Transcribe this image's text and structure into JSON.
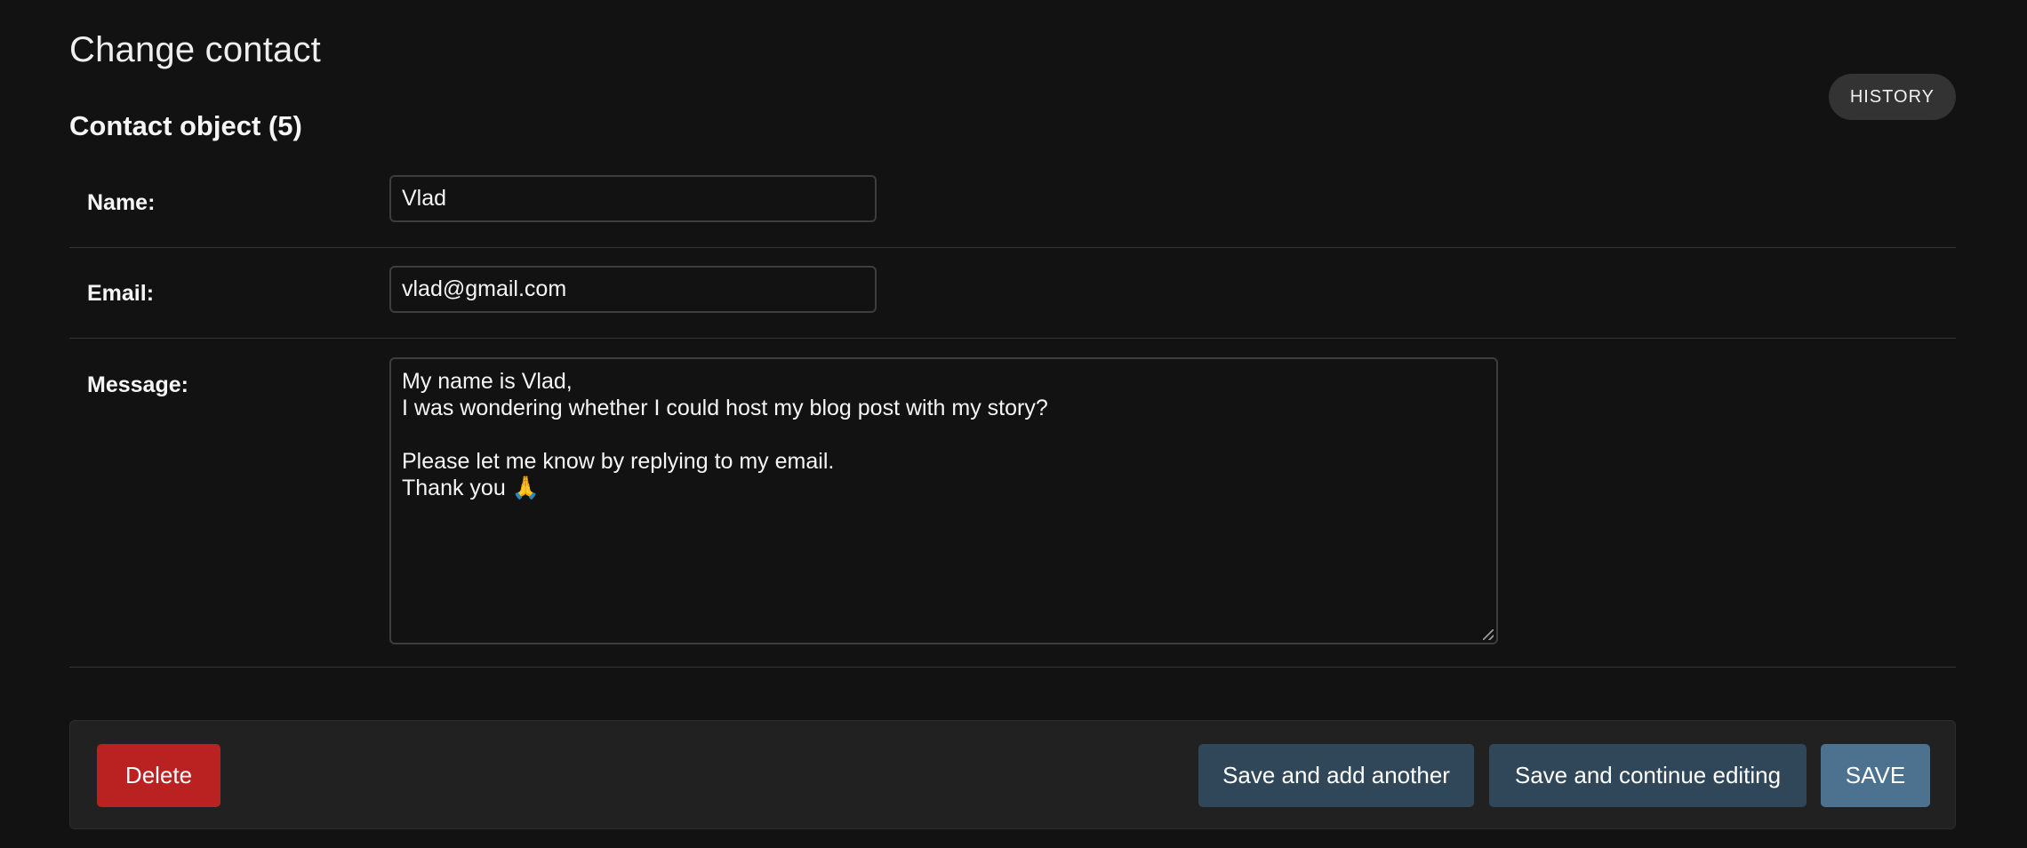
{
  "header": {
    "title": "Change contact",
    "history_label": "HISTORY"
  },
  "object": {
    "title": "Contact object (5)"
  },
  "fields": {
    "name": {
      "label": "Name:",
      "value": "Vlad"
    },
    "email": {
      "label": "Email:",
      "value": "vlad@gmail.com"
    },
    "message": {
      "label": "Message:",
      "value": "My name is Vlad,\nI was wondering whether I could host my blog post with my story?\n\nPlease let me know by replying to my email.\nThank you 🙏"
    }
  },
  "actions": {
    "delete_label": "Delete",
    "save_add_another_label": "Save and add another",
    "save_continue_label": "Save and continue editing",
    "save_label": "SAVE"
  },
  "colors": {
    "background": "#121212",
    "delete": "#ba2121",
    "secondary_button": "#2f4759",
    "primary_button": "#4d7290"
  }
}
